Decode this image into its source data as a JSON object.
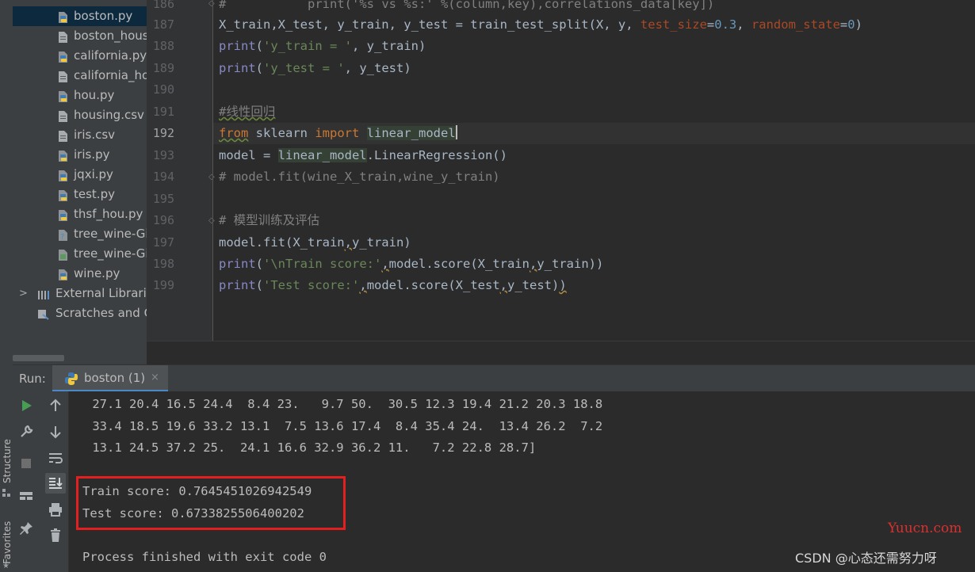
{
  "sidebar": {
    "vertical_tabs": [
      "Structure",
      "Favorites"
    ]
  },
  "project_tree": {
    "items": [
      {
        "label": "boston.py",
        "icon": "python-file-icon",
        "selected": true
      },
      {
        "label": "boston_hous",
        "icon": "text-file-icon"
      },
      {
        "label": "california.py",
        "icon": "python-file-icon"
      },
      {
        "label": "california_ho",
        "icon": "text-file-icon"
      },
      {
        "label": "hou.py",
        "icon": "python-file-icon"
      },
      {
        "label": "housing.csv",
        "icon": "text-file-icon"
      },
      {
        "label": "iris.csv",
        "icon": "text-file-icon"
      },
      {
        "label": "iris.py",
        "icon": "python-file-icon"
      },
      {
        "label": "jqxi.py",
        "icon": "python-file-icon"
      },
      {
        "label": "test.py",
        "icon": "python-file-icon"
      },
      {
        "label": "thsf_hou.py",
        "icon": "python-file-icon"
      },
      {
        "label": "tree_wine-Gi",
        "icon": "unknown-file-icon"
      },
      {
        "label": "tree_wine-Gi",
        "icon": "image-file-icon"
      },
      {
        "label": "wine.py",
        "icon": "python-file-icon"
      },
      {
        "label": "External Librarie",
        "icon": "library-icon"
      },
      {
        "label": "Scratches and C",
        "icon": "scratches-icon"
      }
    ]
  },
  "editor": {
    "line_numbers": [
      "186",
      "187",
      "188",
      "189",
      "190",
      "191",
      "192",
      "193",
      "194",
      "195",
      "196",
      "197",
      "198",
      "199"
    ],
    "current_line": "192",
    "top_comment": "print('%s vs %s:' %(column,key),correlations_data[key])",
    "lines": {
      "l187": {
        "a": "X_train",
        "b": ",X_test, y_train, y_test = train_test_split(X, y, ",
        "c": "test_size",
        "d": "=",
        "e": "0.3",
        "f": ", ",
        "g": "random_state",
        "h": "=",
        "i": "0",
        "j": ")"
      },
      "l188": {
        "a": "print",
        "b": "(",
        "c": "'y_train = '",
        "d": ", y_train)"
      },
      "l189": {
        "a": "print",
        "b": "(",
        "c": "'y_test = '",
        "d": ", y_test)"
      },
      "l191": "#线性回归",
      "l192": {
        "a": "from",
        "b": " sklearn ",
        "c": "import",
        "d": " ",
        "e": "linear_model"
      },
      "l193": {
        "a": "model = ",
        "b": "linear_model",
        "c": ".LinearRegression()"
      },
      "l194": "# model.fit(wine_X_train,wine_y_train)",
      "l196": "# 模型训练及评估",
      "l197": {
        "a": "model.fit(X_train",
        "b": ",",
        "c": "y_train)"
      },
      "l198": {
        "a": "print",
        "b": "(",
        "c": "'\\nTrain score:'",
        "d": ",",
        "e": "model.score(X_train",
        "f": ",",
        "g": "y_train))"
      },
      "l199": {
        "a": "print",
        "b": "(",
        "c": "'Test score:'",
        "d": ",",
        "e": "model.score(X_test",
        "f": ",",
        "g": "y_test)",
        "h": ")"
      }
    }
  },
  "run_panel": {
    "title": "Run:",
    "tab_label": "boston (1)",
    "tab_close": "×",
    "toolbar": [
      "run-icon",
      "up-arrow-icon",
      "wrench-icon",
      "down-arrow-icon",
      "stop-icon",
      "soft-wrap-icon",
      "layout-icon",
      "scroll-to-end-icon",
      "print-icon",
      "pin-icon",
      "trash-icon"
    ],
    "output": [
      " 27.1 20.4 16.5 24.4  8.4 23.   9.7 50.  30.5 12.3 19.4 21.2 20.3 18.8",
      " 33.4 18.5 19.6 33.2 13.1  7.5 13.6 17.4  8.4 35.4 24.  13.4 26.2  7.2",
      " 13.1 24.5 37.2 25.  24.1 16.6 32.9 36.2 11.   7.2 22.8 28.7]",
      "",
      "Train score: 0.7645451026942549",
      "Test score: 0.6733825506400202",
      "",
      "Process finished with exit code 0"
    ]
  },
  "watermarks": {
    "yuucn": "Yuucn.com",
    "csdn": "CSDN @心态还需努力呀"
  },
  "colors": {
    "editor_bg": "#2b2b2b",
    "panel_bg": "#3c3f41",
    "keyword": "#cc7832",
    "string": "#6a8759",
    "number": "#6897bb",
    "highlight_box": "#e31f1f"
  }
}
